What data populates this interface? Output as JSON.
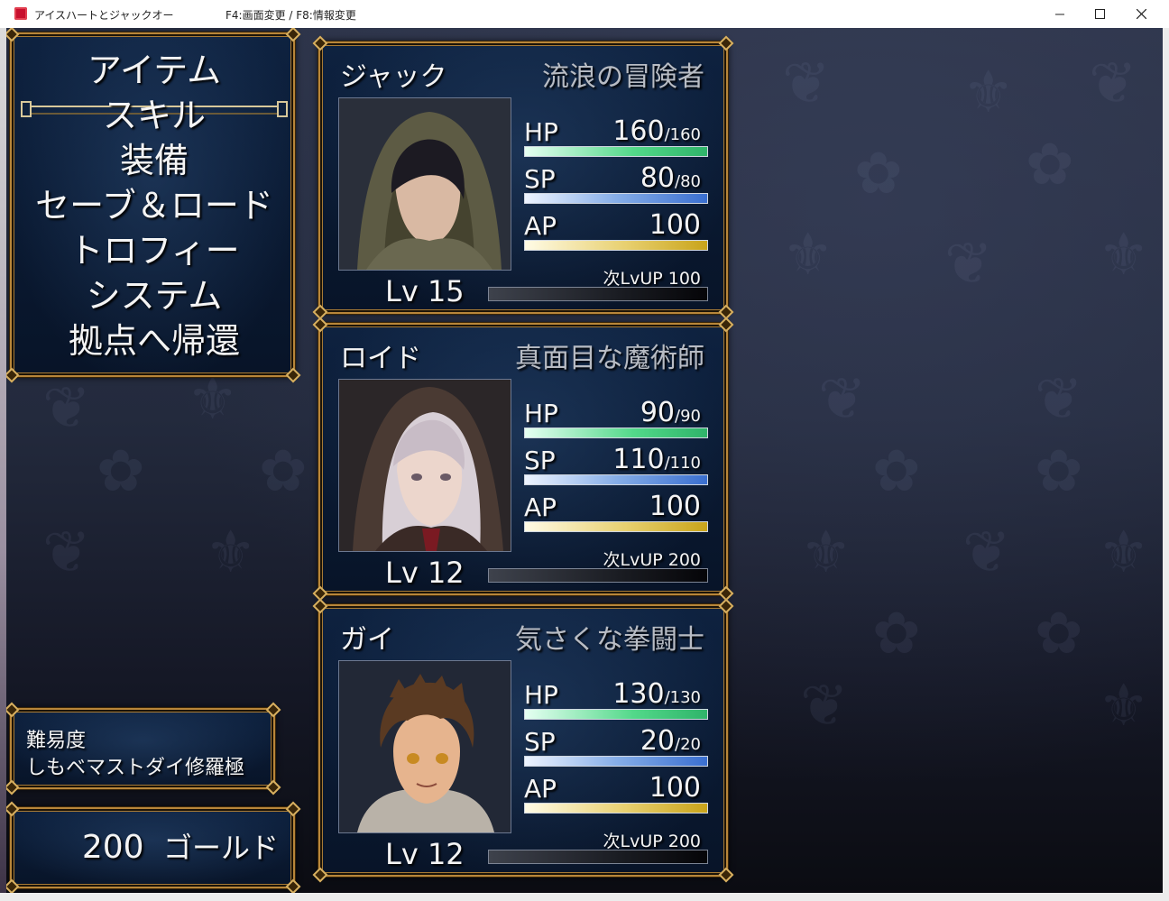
{
  "window": {
    "title": "アイスハートとジャックオー",
    "hint": "F4:画面変更 / F8:情報変更",
    "minimize_icon": "minimize-icon",
    "maximize_icon": "maximize-icon",
    "close_icon": "close-icon"
  },
  "menu": {
    "items": [
      {
        "label": "アイテム"
      },
      {
        "label": "スキル"
      },
      {
        "label": "装備"
      },
      {
        "label": "セーブ＆ロード"
      },
      {
        "label": "トロフィー"
      },
      {
        "label": "システム"
      },
      {
        "label": "拠点へ帰還"
      }
    ],
    "selected_index": 0
  },
  "difficulty": {
    "label": "難易度",
    "value": "しもベマストダイ修羅極"
  },
  "gold": {
    "amount": "200",
    "unit": "ゴールド"
  },
  "party": [
    {
      "name": "ジャック",
      "class": "流浪の冒険者",
      "portrait_icon": "hooded-adventurer-portrait",
      "hp": {
        "label": "HP",
        "current": "160",
        "max": "/160",
        "fill": 1.0
      },
      "sp": {
        "label": "SP",
        "current": "80",
        "max": "/80",
        "fill": 1.0
      },
      "ap": {
        "label": "AP",
        "value": "100",
        "fill": 1.0
      },
      "next_lvup": "次LvUP 100",
      "exp_fill": 0.0,
      "level": "Lv 15"
    },
    {
      "name": "ロイド",
      "class": "真面目な魔術師",
      "portrait_icon": "hooded-mage-portrait",
      "hp": {
        "label": "HP",
        "current": "90",
        "max": "/90",
        "fill": 1.0
      },
      "sp": {
        "label": "SP",
        "current": "110",
        "max": "/110",
        "fill": 1.0
      },
      "ap": {
        "label": "AP",
        "value": "100",
        "fill": 1.0
      },
      "next_lvup": "次LvUP 200",
      "exp_fill": 0.0,
      "level": "Lv 12"
    },
    {
      "name": "ガイ",
      "class": "気さくな拳闘士",
      "portrait_icon": "brawler-portrait",
      "hp": {
        "label": "HP",
        "current": "130",
        "max": "/130",
        "fill": 1.0
      },
      "sp": {
        "label": "SP",
        "current": "20",
        "max": "/20",
        "fill": 1.0
      },
      "ap": {
        "label": "AP",
        "value": "100",
        "fill": 1.0
      },
      "next_lvup": "次LvUP 200",
      "exp_fill": 0.0,
      "level": "Lv 12"
    }
  ],
  "colors": {
    "frame_gold": "#b8863a",
    "panel_navy": "#0a1a33",
    "hp_bar": "#52d889",
    "sp_bar": "#3a6fd0",
    "ap_bar": "#c9a41a"
  }
}
